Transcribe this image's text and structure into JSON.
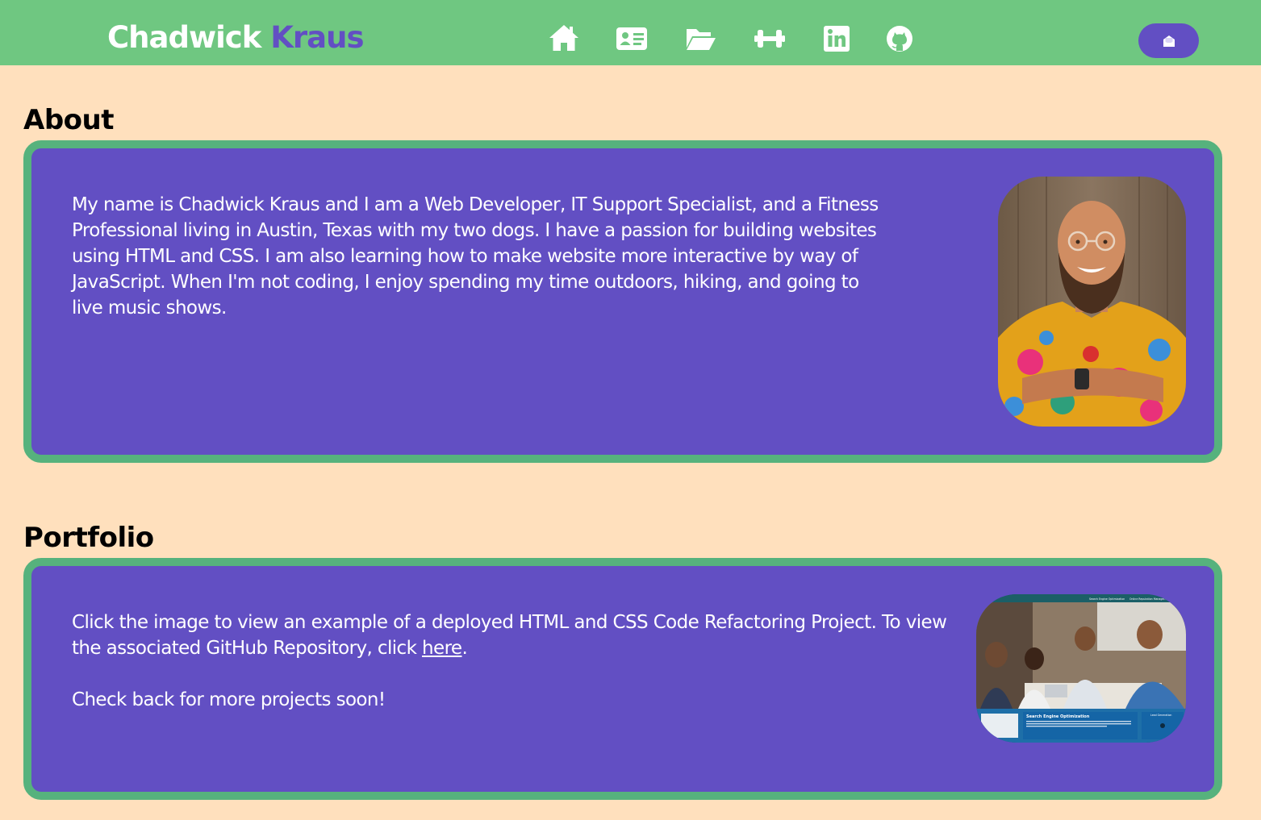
{
  "header": {
    "brand_first": "Chadwick",
    "brand_last": "Kraus",
    "nav_icons": [
      "home-icon",
      "id-card-icon",
      "folder-open-icon",
      "dumbbell-icon",
      "linkedin-icon",
      "github-icon"
    ],
    "contact_icon": "envelope-open-icon"
  },
  "about": {
    "title": "About",
    "body": "My name is Chadwick Kraus and I am a Web Developer, IT Support Specialist, and a Fitness Professional living in Austin, Texas with my two dogs. I have a passion for building websites using HTML and CSS. I am also learning how to make website more interactive by way of JavaScript. When I'm not coding, I enjoy spending my time outdoors, hiking, and going to live music shows."
  },
  "portfolio": {
    "title": "Portfolio",
    "intro": "Click the image to view an example of a deployed HTML and CSS Code Refactoring Project. To view the associated GitHub Repository, click",
    "link_text": "here",
    "after_link": ".",
    "more": "Check back for more projects soon!",
    "thumb_heading": "Search Engine Optimization",
    "thumb_side_heading": "Lead Generation",
    "thumb_nav": [
      "Search Engine Optimization",
      "Online Reputation Management"
    ]
  },
  "colors": {
    "header_bg": "#6fc781",
    "page_bg": "#ffe0bd",
    "card_bg": "#624fc3",
    "card_border": "#56b27d",
    "accent": "#624fc3"
  }
}
